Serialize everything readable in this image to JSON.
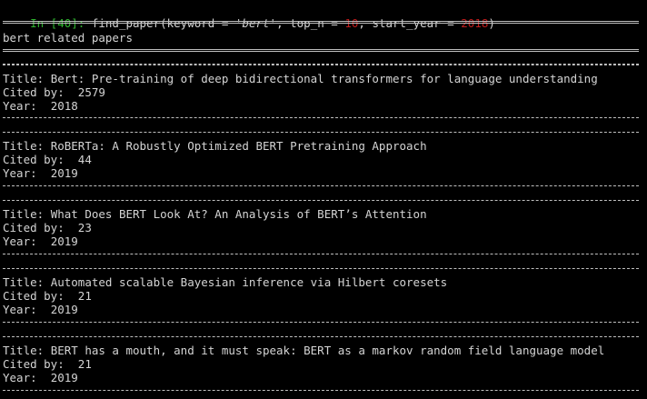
{
  "prompt": {
    "label": "In [40]:",
    "code_before": " find_paper(keyword = ",
    "keyword": "'bert'",
    "code_mid1": ", top_n = ",
    "top_n": "10",
    "code_mid2": ", start_year = ",
    "start_year": "2018",
    "code_after": ")"
  },
  "header": "bert related papers",
  "labels": {
    "title": "Title: ",
    "cited": "Cited by:  ",
    "year": "Year:  "
  },
  "papers": [
    {
      "title": "Bert: Pre-training of deep bidirectional transformers for language understanding",
      "cited_by": "2579",
      "year": "2018"
    },
    {
      "title": "RoBERTa: A Robustly Optimized BERT Pretraining Approach",
      "cited_by": "44",
      "year": "2019"
    },
    {
      "title": "What Does BERT Look At? An Analysis of BERT’s Attention",
      "cited_by": "23",
      "year": "2019"
    },
    {
      "title": "Automated scalable Bayesian inference via Hilbert coresets",
      "cited_by": "21",
      "year": "2019"
    },
    {
      "title": "BERT has a mouth, and it must speak: BERT as a markov random field language model",
      "cited_by": "21",
      "year": "2019"
    }
  ],
  "colors": {
    "background": "#000000",
    "text": "#d4d4d4",
    "prompt": "#2fb32f",
    "number": "#c01c1c"
  }
}
